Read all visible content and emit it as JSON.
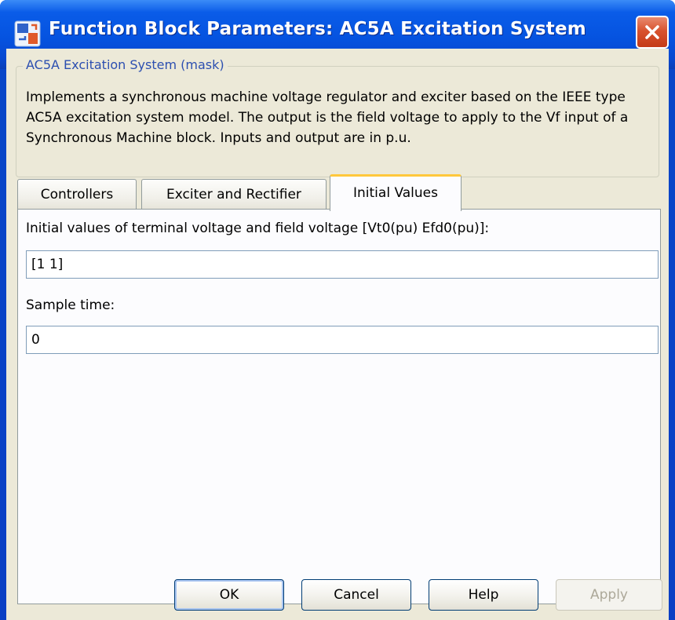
{
  "window": {
    "title": "Function Block Parameters: AC5A Excitation System",
    "title_icon": "simulink-block-icon",
    "close_icon": "close-icon"
  },
  "mask": {
    "title": "AC5A Excitation System (mask)",
    "description": "Implements a synchronous machine voltage regulator and exciter based on the IEEE type AC5A excitation system model. The output is the field voltage to apply to the Vf input of a Synchronous Machine block. Inputs and output are in p.u."
  },
  "tabs": [
    {
      "label": "Controllers",
      "active": false
    },
    {
      "label": "Exciter and Rectifier",
      "active": false
    },
    {
      "label": "Initial Values",
      "active": true
    }
  ],
  "params": {
    "initial_values": {
      "label": "Initial values of terminal voltage and field voltage [Vt0(pu) Efd0(pu)]:",
      "value": "[1 1]"
    },
    "sample_time": {
      "label": "Sample time:",
      "value": "0"
    }
  },
  "buttons": {
    "ok": "OK",
    "cancel": "Cancel",
    "help": "Help",
    "apply": "Apply"
  },
  "colors": {
    "titlebar": "#0553e0",
    "dialog_bg": "#ece9d8",
    "group_title": "#2c4fb0",
    "active_tab_highlight": "#ffc83c",
    "close_button": "#d8532f"
  }
}
